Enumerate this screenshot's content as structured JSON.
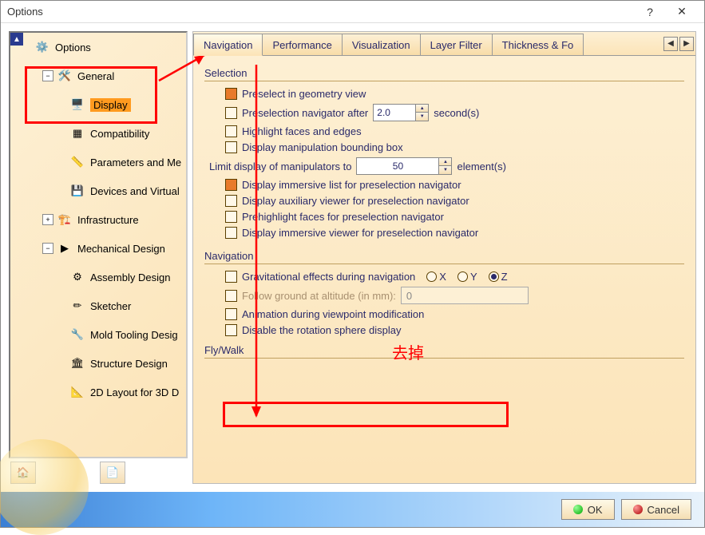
{
  "title": "Options",
  "tree": {
    "root": "Options",
    "node_general": "General",
    "node_display": "Display",
    "node_compatibility": "Compatibility",
    "node_parameters": "Parameters and Me",
    "node_devices": "Devices and Virtual",
    "node_infra": "Infrastructure",
    "node_mechanical": "Mechanical Design",
    "node_assembly": "Assembly Design",
    "node_sketcher": "Sketcher",
    "node_mold": "Mold Tooling Desig",
    "node_structure": "Structure Design",
    "node_2dlayout": "2D Layout for 3D D"
  },
  "tabs": {
    "t1": "Navigation",
    "t2": "Performance",
    "t3": "Visualization",
    "t4": "Layer Filter",
    "t5": "Thickness & Fo"
  },
  "groups": {
    "selection": "Selection",
    "navigation": "Navigation",
    "flywalk": "Fly/Walk"
  },
  "sel": {
    "preselect": "Preselect in geometry view",
    "presel_nav_after": "Preselection navigator after",
    "presel_nav_val": "2.0",
    "seconds": "second(s)",
    "highlight": "Highlight faces and edges",
    "display_manip_bbox": "Display manipulation bounding box",
    "limit_manip": "Limit display of manipulators to",
    "limit_val": "50",
    "elements": "element(s)",
    "immersive_list": "Display immersive list for preselection navigator",
    "aux_viewer": "Display auxiliary viewer for preselection navigator",
    "prehighlight": "Prehighlight faces for preselection navigator",
    "immersive_viewer": "Display immersive viewer for preselection navigator"
  },
  "nav": {
    "gravitational": "Gravitational effects during navigation",
    "axis_x": "X",
    "axis_y": "Y",
    "axis_z": "Z",
    "follow_ground": "Follow ground at altitude (in mm):",
    "altitude_val": "0",
    "animation": "Animation during viewpoint modification",
    "disable_sphere": "Disable the rotation sphere display"
  },
  "buttons": {
    "ok": "OK",
    "cancel": "Cancel"
  },
  "annotation": {
    "remove": "去掉"
  }
}
